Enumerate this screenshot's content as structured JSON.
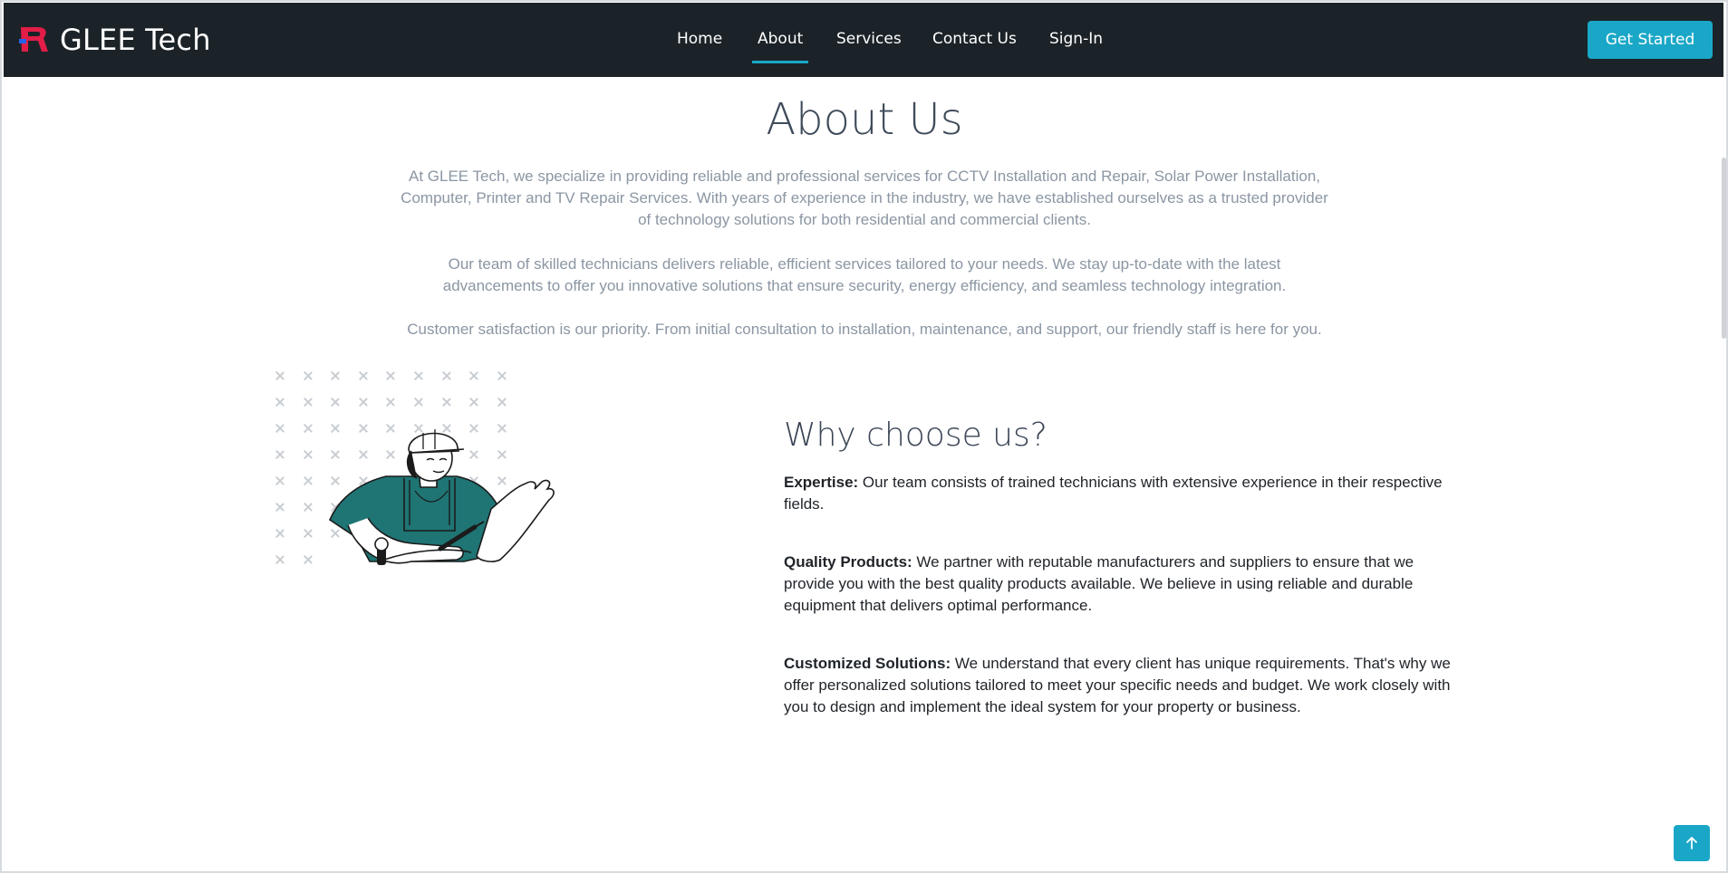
{
  "header": {
    "brand": "GLEE Tech",
    "nav": [
      "Home",
      "About",
      "Services",
      "Contact Us",
      "Sign-In"
    ],
    "active": "About",
    "cta": "Get Started",
    "colors": {
      "bar": "#1b2328",
      "accent": "#1aa7c7",
      "logo_red": "#e11d48",
      "logo_blue": "#2563eb"
    }
  },
  "about": {
    "title": "About Us",
    "p1": "At GLEE Tech, we specialize in providing reliable and professional services for CCTV Installation and Repair, Solar Power Installation, Computer, Printer and TV Repair Services. With years of experience in the industry, we have established ourselves as a trusted provider of technology solutions for both residential and commercial clients.",
    "p2": "Our team of skilled technicians delivers reliable, efficient services tailored to your needs. We stay up-to-date with the latest advancements to offer you innovative solutions that ensure security, energy efficiency, and seamless technology integration.",
    "p3": "Customer satisfaction is our priority. From initial consultation to installation, maintenance, and support, our friendly staff is here for you."
  },
  "why": {
    "title": "Why choose us?",
    "items": [
      {
        "label": "Expertise:",
        "text": " Our team consists of trained technicians with extensive experience in their respective fields."
      },
      {
        "label": "Quality Products:",
        "text": " We partner with reputable manufacturers and suppliers to ensure that we provide you with the best quality products available. We believe in using reliable and durable equipment that delivers optimal performance."
      },
      {
        "label": "Customized Solutions:",
        "text": " We understand that every client has unique requirements. That's why we offer personalized solutions tailored to meet your specific needs and budget. We work closely with you to design and implement the ideal system for your property or business."
      }
    ]
  },
  "icons": {
    "scroll_top": "arrow-up-icon",
    "illustration": "technician-illustration"
  }
}
